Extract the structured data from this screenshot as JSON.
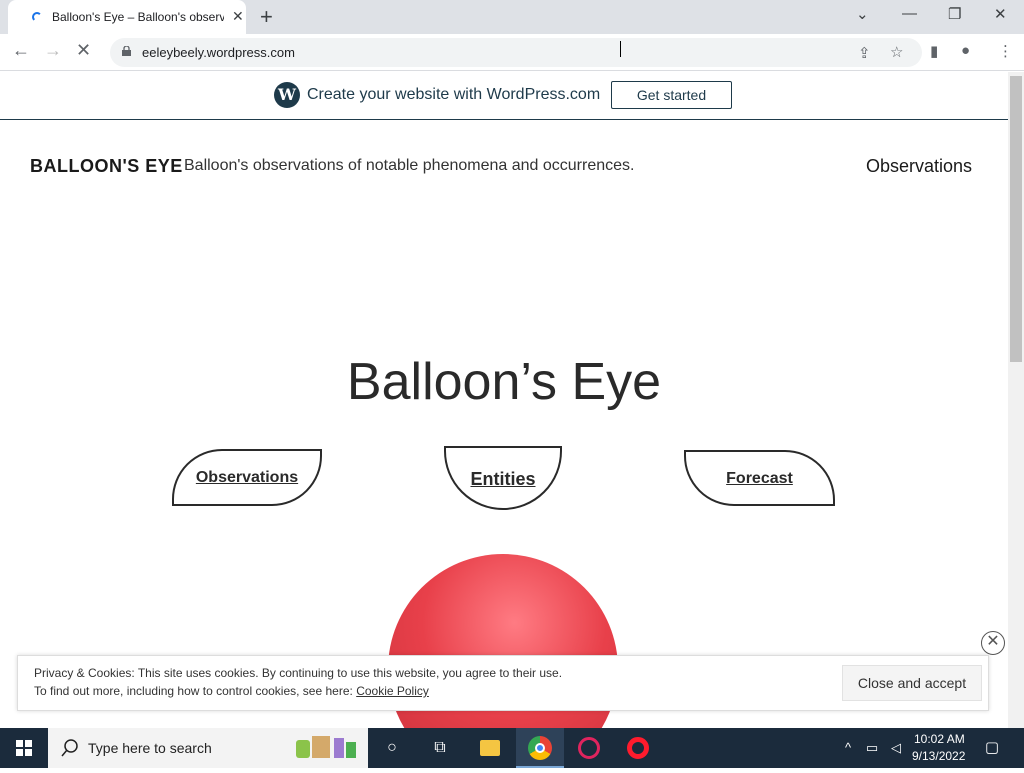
{
  "browser": {
    "tab_title": "Balloon's Eye – Balloon's observa",
    "url": "eeleybeely.wordpress.com"
  },
  "wp_banner": {
    "text": "Create your website with WordPress.com",
    "button": "Get started"
  },
  "site": {
    "title": "BALLOON'S EYE",
    "tagline": "Balloon's observations of notable phenomena and occurrences.",
    "nav_item": "Observations"
  },
  "hero": {
    "title": "Balloon’s Eye",
    "links": [
      "Observations",
      "Entities",
      "Forecast"
    ]
  },
  "cookie": {
    "line1": "Privacy & Cookies: This site uses cookies. By continuing to use this website, you agree to their use.",
    "line2": "To find out more, including how to control cookies, see here: ",
    "link": "Cookie Policy",
    "accept": "Close and accept"
  },
  "taskbar": {
    "search_placeholder": "Type here to search",
    "time": "10:02 AM",
    "date": "9/13/2022"
  },
  "colors": {
    "balloon": "#e8404a",
    "wp_navy": "#1e3a4a",
    "taskbar": "#1b2b3c"
  }
}
